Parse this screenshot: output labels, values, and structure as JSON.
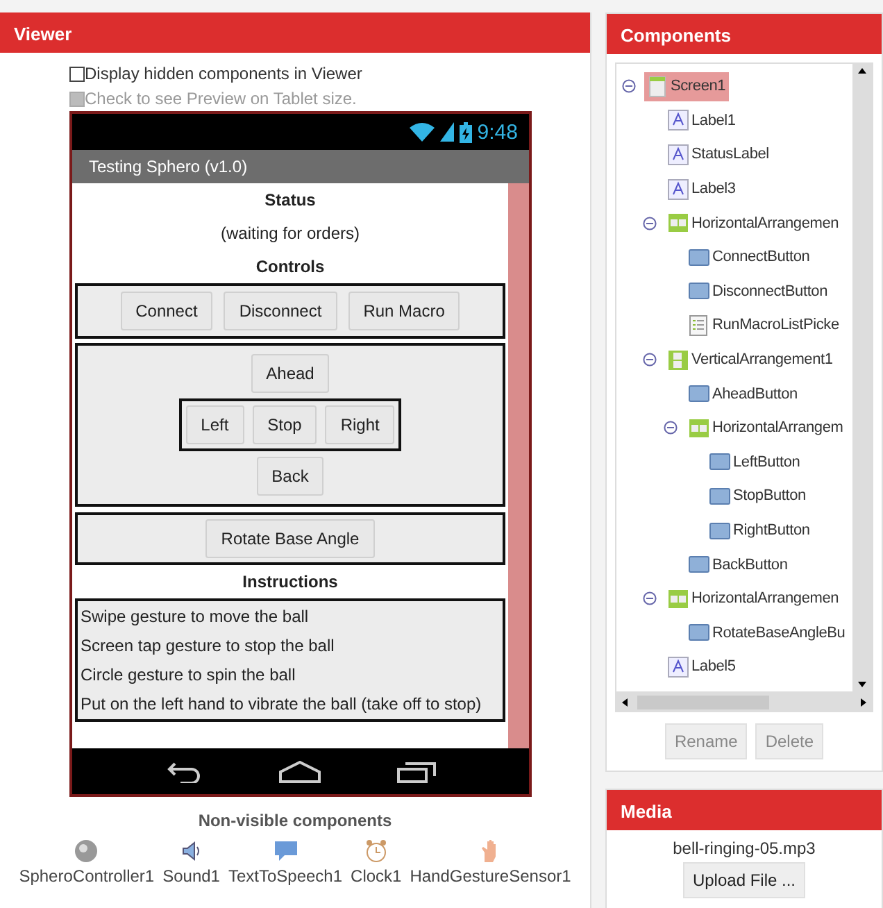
{
  "viewer": {
    "title": "Viewer",
    "options": [
      {
        "label": "Display hidden components in Viewer",
        "checked": false,
        "disabled": false
      },
      {
        "label": "Check to see Preview on Tablet size.",
        "checked": false,
        "disabled": true
      }
    ],
    "phone": {
      "time": "9:48",
      "app_title": "Testing Sphero (v1.0)",
      "status_heading": "Status",
      "status_text": "(waiting for orders)",
      "controls_heading": "Controls",
      "control_buttons": [
        "Connect",
        "Disconnect",
        "Run Macro"
      ],
      "ahead": "Ahead",
      "direction_buttons": [
        "Left",
        "Stop",
        "Right"
      ],
      "back": "Back",
      "rotate_button": "Rotate Base Angle",
      "instructions_heading": "Instructions",
      "instructions": [
        "Swipe gesture to move the ball",
        "Screen tap gesture to stop the ball",
        "Circle gesture to spin the ball",
        "Put on the left hand to vibrate the ball (take off to stop)"
      ]
    },
    "nonvisible_title": "Non-visible components",
    "nonvisible": [
      {
        "label": "SpheroController1",
        "kind": "sphere"
      },
      {
        "label": "Sound1",
        "kind": "speaker"
      },
      {
        "label": "TextToSpeech1",
        "kind": "speech"
      },
      {
        "label": "Clock1",
        "kind": "clock"
      },
      {
        "label": "HandGestureSensor1",
        "kind": "hand"
      }
    ]
  },
  "components": {
    "title": "Components",
    "tree": [
      {
        "label": "Screen1",
        "kind": "screen",
        "selected": true,
        "expanded": true,
        "children": [
          {
            "label": "Label1",
            "kind": "label",
            "selected": false
          },
          {
            "label": "StatusLabel",
            "kind": "label",
            "selected": false
          },
          {
            "label": "Label3",
            "kind": "label",
            "selected": false
          },
          {
            "label": "HorizontalArrangemen",
            "kind": "harrangement",
            "selected": false,
            "expanded": true,
            "children": [
              {
                "label": "ConnectButton",
                "kind": "button",
                "selected": false
              },
              {
                "label": "DisconnectButton",
                "kind": "button",
                "selected": false
              },
              {
                "label": "RunMacroListPicke",
                "kind": "listpicker",
                "selected": false
              }
            ]
          },
          {
            "label": "VerticalArrangement1",
            "kind": "varrangement",
            "selected": false,
            "expanded": true,
            "children": [
              {
                "label": "AheadButton",
                "kind": "button",
                "selected": false
              },
              {
                "label": "HorizontalArrangem",
                "kind": "harrangement",
                "selected": false,
                "expanded": true,
                "children": [
                  {
                    "label": "LeftButton",
                    "kind": "button",
                    "selected": false
                  },
                  {
                    "label": "StopButton",
                    "kind": "button",
                    "selected": false
                  },
                  {
                    "label": "RightButton",
                    "kind": "button",
                    "selected": false
                  }
                ]
              },
              {
                "label": "BackButton",
                "kind": "button",
                "selected": false
              }
            ]
          },
          {
            "label": "HorizontalArrangemen",
            "kind": "harrangement",
            "selected": false,
            "expanded": true,
            "children": [
              {
                "label": "RotateBaseAngleBu",
                "kind": "button",
                "selected": false
              }
            ]
          },
          {
            "label": "Label5",
            "kind": "label",
            "selected": false
          }
        ]
      }
    ],
    "buttons": [
      {
        "label": "Rename",
        "disabled": true
      },
      {
        "label": "Delete",
        "disabled": true
      }
    ]
  },
  "media": {
    "title": "Media",
    "files": [
      "bell-ringing-05.mp3"
    ],
    "upload_button": "Upload File ..."
  }
}
